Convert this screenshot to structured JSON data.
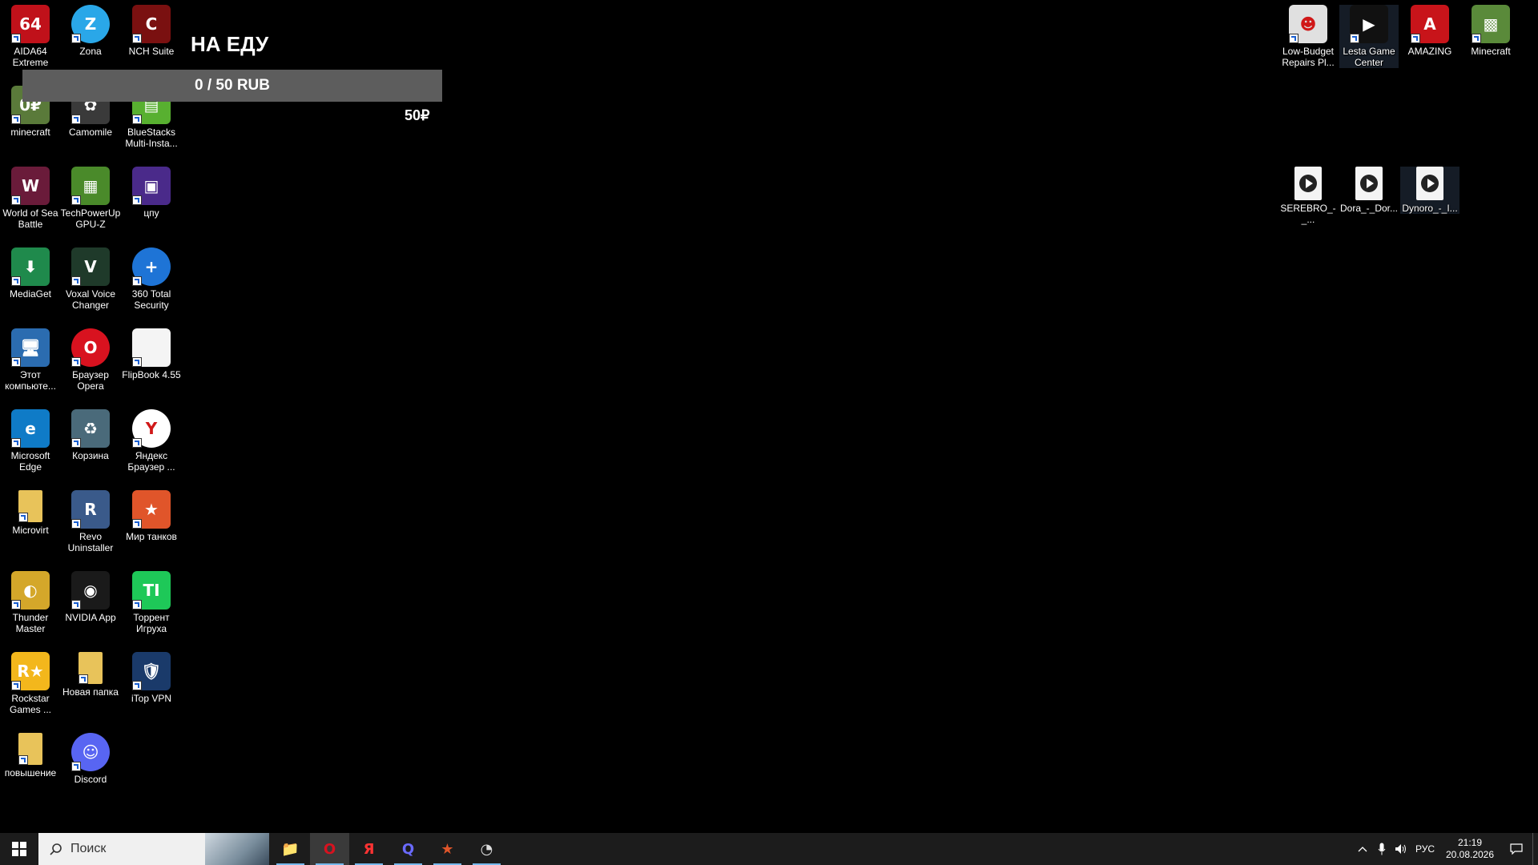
{
  "desktop": {
    "column1": [
      {
        "label": "AIDA64 Extreme",
        "glyph": "64",
        "bg": "#c0111a",
        "icon": "aida64-icon"
      },
      {
        "label": "minecraft",
        "glyph": "0₽",
        "bg": "#5a7a3a",
        "icon": "minecraft-grass-icon"
      },
      {
        "label": "World of Sea Battle",
        "glyph": "W",
        "bg": "#6a1b3a",
        "icon": "sea-battle-icon"
      },
      {
        "label": "MediaGet",
        "glyph": "⬇",
        "bg": "#1f8a4c",
        "icon": "mediaget-icon"
      },
      {
        "label": "Этот компьюте...",
        "glyph": "🖥",
        "bg": "#2b6cb0",
        "icon": "computer-icon"
      },
      {
        "label": "Microsoft Edge",
        "glyph": "e",
        "bg": "#0f7bc7",
        "icon": "edge-icon"
      },
      {
        "label": "Microvirt",
        "glyph": "",
        "bg": "#e8c35a",
        "icon": "folder-icon"
      },
      {
        "label": "Thunder Master",
        "glyph": "◐",
        "bg": "#d4a72a",
        "icon": "thunder-master-icon"
      },
      {
        "label": "Rockstar Games ...",
        "glyph": "R★",
        "bg": "#f3b71c",
        "icon": "rockstar-icon"
      },
      {
        "label": "повышение",
        "glyph": "",
        "bg": "#e8c35a",
        "icon": "folder-icon"
      }
    ],
    "column2": [
      {
        "label": "Zona",
        "glyph": "Z",
        "bg": "#2aa7e8",
        "icon": "zona-icon",
        "round": true
      },
      {
        "label": "Camomile",
        "glyph": "✿",
        "bg": "#3a3a3a",
        "icon": "camomile-icon"
      },
      {
        "label": "TechPowerUp GPU-Z",
        "glyph": "▦",
        "bg": "#4a8a2a",
        "icon": "gpuz-icon"
      },
      {
        "label": "Voxal Voice Changer",
        "glyph": "V",
        "bg": "#1f3a2a",
        "icon": "voxal-icon"
      },
      {
        "label": "Браузер Opera",
        "glyph": "O",
        "bg": "#d8121f",
        "icon": "opera-icon",
        "round": true
      },
      {
        "label": "Корзина",
        "glyph": "♻",
        "bg": "#4a6a7a",
        "icon": "recycle-bin-icon"
      },
      {
        "label": "Revo Uninstaller",
        "glyph": "R",
        "bg": "#3a5a8a",
        "icon": "revo-icon"
      },
      {
        "label": "NVIDIA App",
        "glyph": "◉",
        "bg": "#1a1a1a",
        "icon": "nvidia-icon"
      },
      {
        "label": "Новая папка",
        "glyph": "",
        "bg": "#e8c35a",
        "icon": "folder-icon"
      },
      {
        "label": "Discord",
        "glyph": "☺",
        "bg": "#5865f2",
        "icon": "discord-icon",
        "round": true
      }
    ],
    "column3": [
      {
        "label": "NCH Suite",
        "glyph": "C",
        "bg": "#7a1010",
        "icon": "nch-suite-icon"
      },
      {
        "label": "BlueStacks Multi-Insta...",
        "glyph": "▤",
        "bg": "#58b030",
        "icon": "bluestacks-icon"
      },
      {
        "label": "цпу",
        "glyph": "▣",
        "bg": "#4a2a8a",
        "icon": "cpu-icon"
      },
      {
        "label": "360 Total Security",
        "glyph": "+",
        "bg": "#1e74d6",
        "icon": "total-security-icon",
        "round": true
      },
      {
        "label": "FlipBook 4.55",
        "glyph": "",
        "bg": "#f4f4f4",
        "icon": "blank-file-icon"
      },
      {
        "label": "Яндекс Браузер ...",
        "glyph": "Y",
        "bg": "#ffffff",
        "icon": "yandex-browser-icon",
        "round": true
      },
      {
        "label": "Мир танков",
        "glyph": "★",
        "bg": "#e0552a",
        "icon": "mir-tankov-icon"
      },
      {
        "label": "Торрент Игруха",
        "glyph": "TI",
        "bg": "#1ec858",
        "icon": "torrent-igruha-icon"
      },
      {
        "label": "iTop VPN",
        "glyph": "🛡",
        "bg": "#1a3a6a",
        "icon": "itop-vpn-icon"
      }
    ],
    "top_right": [
      {
        "label": "Low-Budget Repairs Pl...",
        "glyph": "☻",
        "bg": "#e0e0e0",
        "icon": "low-budget-repairs-icon"
      },
      {
        "label": "Lesta Game Center",
        "glyph": "▶",
        "bg": "#111111",
        "icon": "lesta-icon",
        "selected": true
      },
      {
        "label": "AMAZING",
        "glyph": "A",
        "bg": "#c8141a",
        "icon": "amazing-icon"
      },
      {
        "label": "Minecraft",
        "glyph": "▩",
        "bg": "#5a8a3a",
        "icon": "minecraft-icon"
      }
    ],
    "media_files": [
      {
        "label": "SEREBRO_-_...",
        "icon": "media-file-icon"
      },
      {
        "label": "Dora_-_Dor...",
        "icon": "media-file-icon"
      },
      {
        "label": "Dynoro_-_I...",
        "icon": "media-file-icon",
        "selected": true
      }
    ]
  },
  "widget": {
    "title": "НА ЕДУ",
    "progress_text": "0 / 50 RUB",
    "progress_fraction": 0,
    "goal_amount": "50₽"
  },
  "taskbar": {
    "search_placeholder": "Поиск",
    "apps": [
      {
        "name": "file-explorer",
        "glyph": "📁",
        "color": "#e8c35a"
      },
      {
        "name": "opera",
        "glyph": "O",
        "color": "#d8121f",
        "active": true
      },
      {
        "name": "yandex",
        "glyph": "Я",
        "color": "#ff3333"
      },
      {
        "name": "app-q",
        "glyph": "Q",
        "color": "#6a6aff"
      },
      {
        "name": "mir-tankov",
        "glyph": "★",
        "color": "#e0552a"
      },
      {
        "name": "app-clock",
        "glyph": "◔",
        "color": "#dddddd"
      }
    ],
    "language": "РУС",
    "time": "21:19",
    "date": "20.08.2026"
  }
}
